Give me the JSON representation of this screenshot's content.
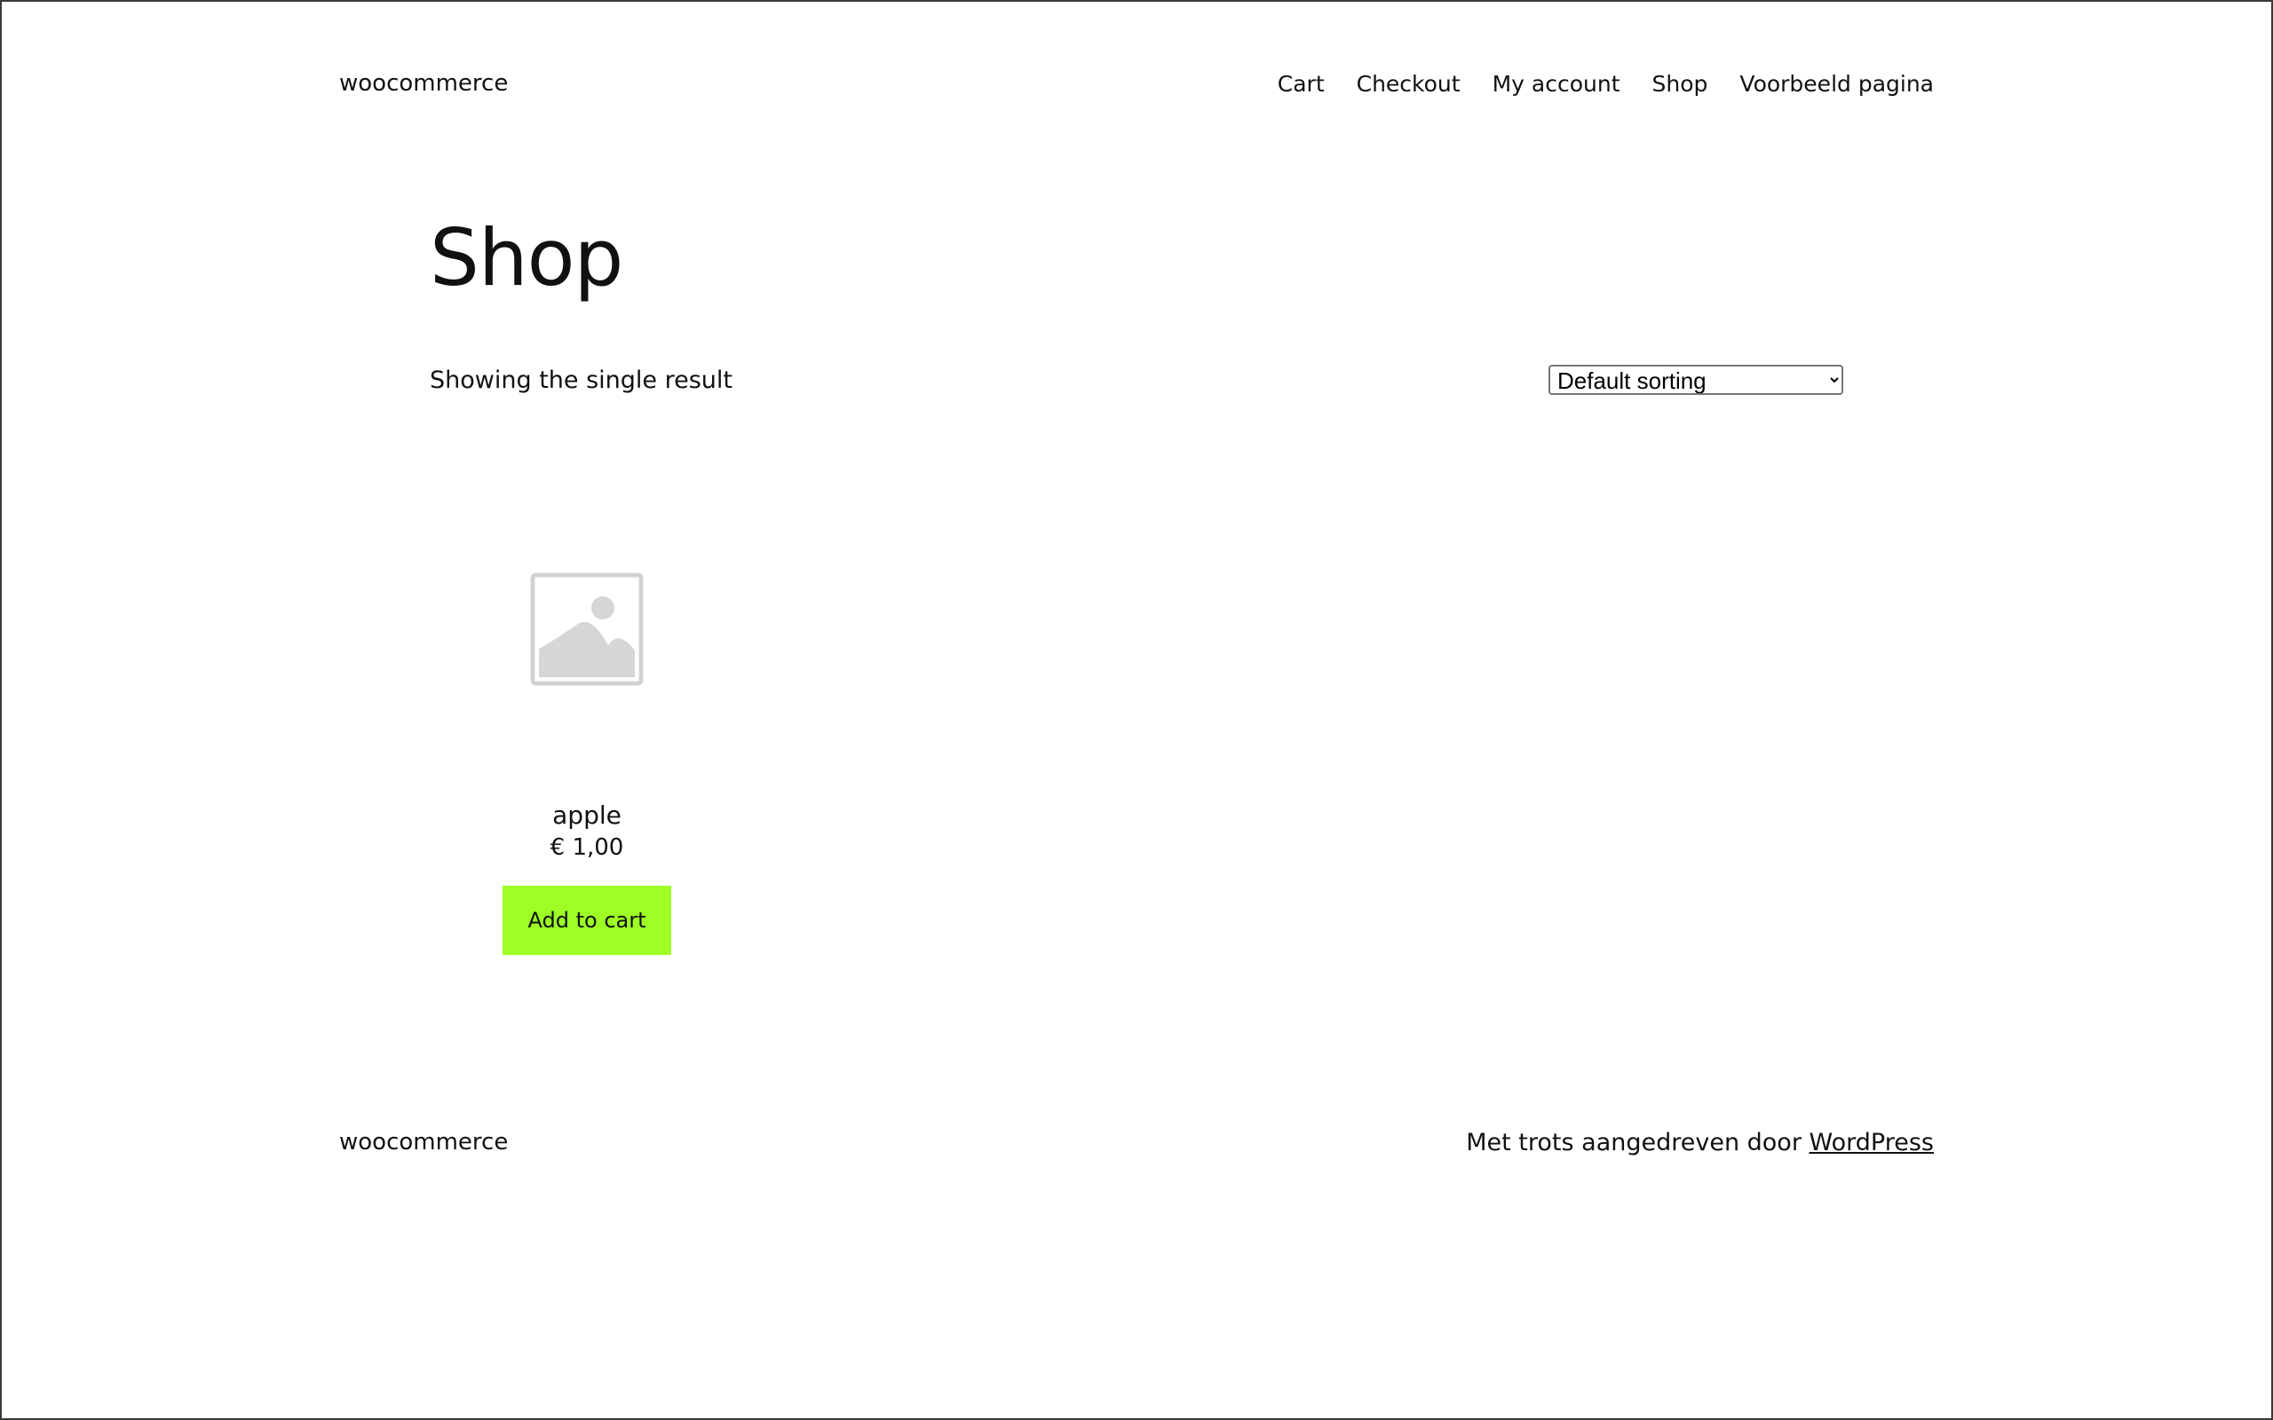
{
  "header": {
    "site_title": "woocommerce",
    "nav": [
      "Cart",
      "Checkout",
      "My account",
      "Shop",
      "Voorbeeld pagina"
    ]
  },
  "main": {
    "page_title": "Shop",
    "result_count": "Showing the single result",
    "sort": {
      "selected": "Default sorting"
    },
    "products": [
      {
        "name": "apple",
        "price": "€ 1,00",
        "button_label": "Add to cart",
        "image_icon": "image-placeholder-icon"
      }
    ]
  },
  "footer": {
    "site_title": "woocommerce",
    "credit_text": "Met trots aangedreven door",
    "credit_link": "WordPress"
  },
  "colors": {
    "button_bg": "#9dff24",
    "text": "#111111",
    "placeholder_icon": "#d6d6d6"
  }
}
